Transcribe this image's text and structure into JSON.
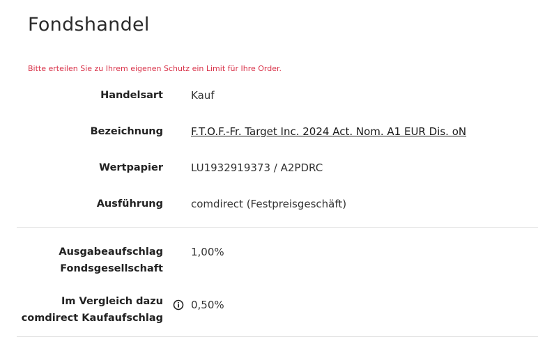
{
  "page": {
    "title": "Fondshandel",
    "warning": "Bitte erteilen Sie zu Ihrem eigenen Schutz ein Limit für Ihre Order."
  },
  "details": {
    "handelsart_label": "Handelsart",
    "handelsart_value": "Kauf",
    "bezeichnung_label": "Bezeichnung",
    "bezeichnung_value": "F.T.O.F.-Fr. Target Inc. 2024 Act. Nom. A1 EUR Dis. oN",
    "wertpapier_label": "Wertpapier",
    "wertpapier_value": "LU1932919373 / A2PDRC",
    "ausfuehrung_label": "Ausführung",
    "ausfuehrung_value": "comdirect (Festpreisgeschäft)"
  },
  "fees": {
    "ausgabeaufschlag_label_line1": "Ausgabeaufschlag",
    "ausgabeaufschlag_label_line2": "Fondsgesellschaft",
    "ausgabeaufschlag_value": "1,00%",
    "vergleich_label_line1": "Im Vergleich dazu",
    "vergleich_label_line2": "comdirect Kaufaufschlag",
    "vergleich_value": "0,50%",
    "info_icon": "info-circle-icon"
  },
  "colors": {
    "warning": "#d9334a",
    "text": "#222222",
    "divider": "#e4e4e4"
  }
}
